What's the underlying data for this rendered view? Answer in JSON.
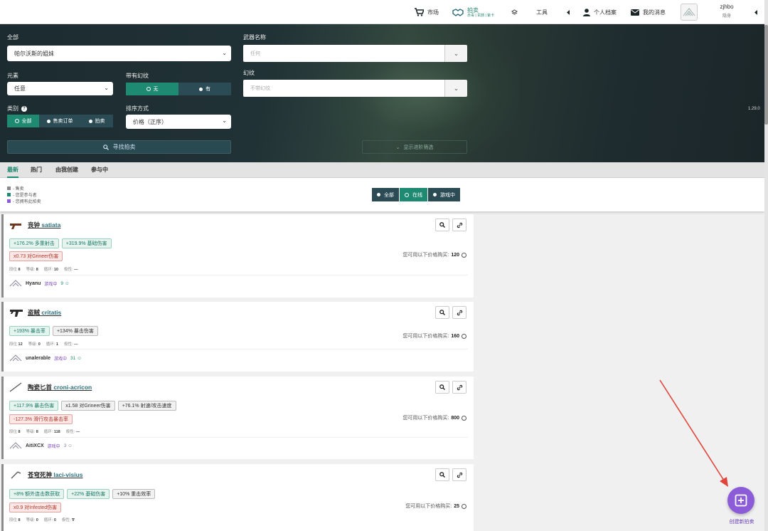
{
  "nav": {
    "market": "市场",
    "auction_main": "拍卖",
    "auction_sub": "赤毒 | 玄骸 | 紫卡",
    "tools": "工具",
    "profile": "个人档案",
    "messages": "我的消息",
    "username": "zjhbo",
    "user_status": "隐身"
  },
  "filter": {
    "category_label": "全部",
    "category_value": "帕尔沃斯的姐妹",
    "weapon_label": "武器名称",
    "weapon_placeholder": "任何",
    "element_label": "元素",
    "element_value": "任意",
    "ephemera_label": "带有幻纹",
    "ephemera_no": "无",
    "ephemera_yes": "有",
    "riven_label": "幻纹",
    "riven_placeholder": "不带幻纹",
    "type_label": "类别",
    "type_all": "全部",
    "type_sell": "售卖订单",
    "type_auction": "拍卖",
    "sort_label": "排序方式",
    "sort_value": "价格（正序）",
    "search_button": "寻找拍卖",
    "advanced_button": "显示进阶筛选",
    "version": "1.29.0"
  },
  "tabs": [
    "最新",
    "热门",
    "由我创建",
    "参与中"
  ],
  "legend": [
    {
      "text": "- 售卖",
      "color": "#8a8a8a"
    },
    {
      "text": "- 您是参与者",
      "color": "#1f8a72"
    },
    {
      "text": "- 您拥有此拍卖",
      "color": "#8c5bd8"
    }
  ],
  "status_filter": {
    "all": "全部",
    "online": "在线",
    "ingame": "游戏中"
  },
  "price_label": "您可用以下价格购买:",
  "stat_labels": {
    "rank": "段位",
    "mastery": "等级",
    "rolls": "循环",
    "polarity": "极性"
  },
  "listings": [
    {
      "weapon_cn": "丧钟",
      "weapon_en": "satiata",
      "positives": [
        "+176.2% 多重射击",
        "+319.9% 基础伤害"
      ],
      "neutrals": [],
      "negatives": [
        "x0.73 对Grineer伤害"
      ],
      "rank": "8",
      "mastery": "8",
      "rolls": "10",
      "polarity": "—",
      "seller": "Hyanu",
      "status": "游戏中",
      "rep": "9 ☺",
      "price": "120"
    },
    {
      "weapon_cn": "盗贼",
      "weapon_en": "critatis",
      "positives": [
        "+193% 暴击率",
        "+134% 暴击伤害"
      ],
      "neutrals": [],
      "negatives": [],
      "rank": "12",
      "mastery": "0",
      "rolls": "1",
      "polarity": "—",
      "seller": "unalerable",
      "status": "游戏中",
      "rep": "31 ☺",
      "price": "160"
    },
    {
      "weapon_cn": "陶瓷匕首",
      "weapon_en": "croni-acricon",
      "positives": [
        "+117.9% 暴击伤害"
      ],
      "neutrals": [
        "x1.58 对Grineer伤害",
        "+76.1% 射速/攻击速度"
      ],
      "negatives": [
        "-127.3% 滑行攻击暴击率"
      ],
      "rank": "8",
      "mastery": "8",
      "rolls": "118",
      "polarity": "—",
      "seller": "AitiXCX",
      "status": "游戏中",
      "rep": "3 ☺",
      "price": "800"
    },
    {
      "weapon_cn": "苍穹死神",
      "weapon_en": "laci-visius",
      "positives": [
        "+8% 额外连击数获取",
        "+22% 基础伤害"
      ],
      "neutrals": [
        "+10% 重击效率"
      ],
      "negatives": [
        "x0.9 对Infested伤害"
      ],
      "rank": "8",
      "mastery": "0",
      "rolls": "0",
      "polarity": "∇",
      "seller": "",
      "status": "",
      "rep": "",
      "price": "25"
    }
  ],
  "fab_label": "创建新拍卖",
  "colors": {
    "accent": "#1f8a72",
    "purple": "#8c5bd8",
    "dark": "#1f2c2f",
    "negative": "#b03a2e"
  }
}
